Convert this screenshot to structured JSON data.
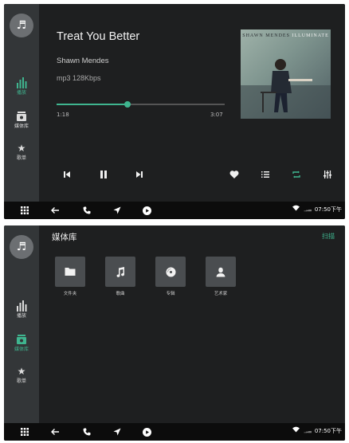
{
  "player": {
    "sidebar": {
      "logo_glyph": "♬",
      "items": [
        {
          "label": "播放",
          "icon": "equalizer-bars",
          "active": true
        },
        {
          "label": "媒体库",
          "icon": "radio",
          "active": false
        },
        {
          "label": "歌单",
          "icon": "star",
          "active": false
        }
      ]
    },
    "now_playing": {
      "title": "Treat You Better",
      "artist": "Shawn Mendes",
      "format": "mp3  128Kbps",
      "elapsed": "1:18",
      "duration": "3:07",
      "progress": 0.42
    },
    "album_art": {
      "artist_text": "SHAWN MENDES",
      "album_text": "ILLUMINATE"
    },
    "controls": [
      {
        "name": "previous",
        "glyph": "⏮"
      },
      {
        "name": "pause",
        "glyph": "⏸"
      },
      {
        "name": "next",
        "glyph": "⏭"
      },
      {
        "name": "favorite",
        "glyph": "♥"
      },
      {
        "name": "playlist",
        "glyph": "☰"
      },
      {
        "name": "repeat",
        "glyph": "⟳"
      },
      {
        "name": "equalizer",
        "glyph": "⫶"
      }
    ]
  },
  "library": {
    "sidebar": {
      "logo_glyph": "♬",
      "items": [
        {
          "label": "播放",
          "icon": "equalizer-bars",
          "active": false
        },
        {
          "label": "媒体库",
          "icon": "radio",
          "active": true
        },
        {
          "label": "歌单",
          "icon": "star",
          "active": false
        }
      ]
    },
    "title": "媒体库",
    "scan_label": "扫描",
    "categories": [
      {
        "label": "文件夹",
        "icon": "folder"
      },
      {
        "label": "歌曲",
        "icon": "music-note"
      },
      {
        "label": "专辑",
        "icon": "disc"
      },
      {
        "label": "艺术家",
        "icon": "person"
      }
    ]
  },
  "bottom_bar": {
    "time": "07:50下午",
    "icons": [
      "apps-grid",
      "back-arrow",
      "phone",
      "navigation",
      "play-circle"
    ]
  },
  "colors": {
    "accent": "#3fb58f",
    "background": "#1f2122",
    "sidebar": "#333638",
    "bar": "#0c0c0c"
  }
}
